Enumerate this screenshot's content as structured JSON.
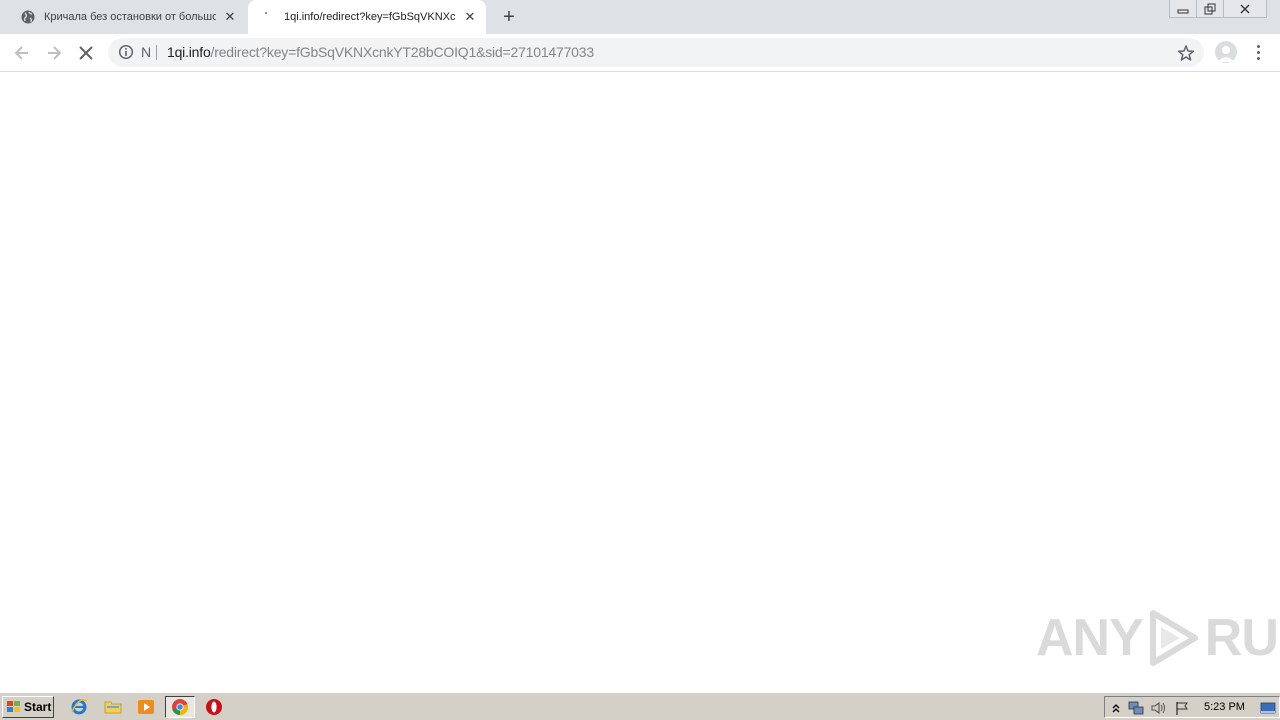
{
  "browser": {
    "tabs": [
      {
        "title": "Кричала без остановки от большо",
        "active": false
      },
      {
        "title": "1qi.info/redirect?key=fGbSqVKNXcnk",
        "active": true
      }
    ],
    "new_tab_symbol": "+",
    "address": {
      "security_text": "N",
      "host": "1qi.info",
      "path": "/redirect?key=fGbSqVKNXcnkYT28bCOIQ1&sid=27101477033"
    }
  },
  "watermark": {
    "left": "ANY",
    "right": "RUN"
  },
  "taskbar": {
    "start_label": "Start",
    "clock": "5:23 PM",
    "apps": [
      "internet-explorer",
      "file-explorer",
      "media-player",
      "chrome",
      "opera"
    ]
  },
  "colors": {
    "tabstrip": "#dee1e6",
    "omnibox": "#f1f3f4",
    "taskbar": "#d4d0c8"
  }
}
